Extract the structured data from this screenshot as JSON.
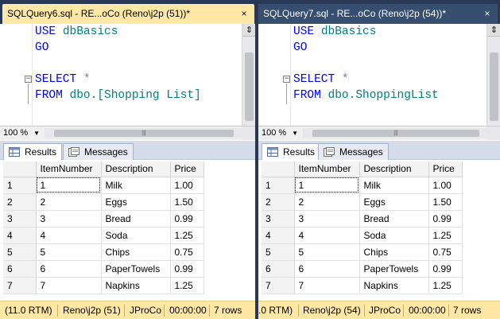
{
  "panes": [
    {
      "tab_title": "SQLQuery6.sql - RE...oCo (Reno\\j2p (51))*",
      "tab_close": "×",
      "code": {
        "line1_kw": "USE",
        "line1_id": "dbBasics",
        "line2_kw": "GO",
        "line3_kw": "SELECT",
        "line3_op": "*",
        "line4_kw": "FROM",
        "line4_id": "dbo.[Shopping List]"
      },
      "zoom": "100 %",
      "results_tab": "Results",
      "messages_tab": "Messages",
      "grid": {
        "headers": [
          "ItemNumber",
          "Description",
          "Price"
        ],
        "rows": [
          [
            "1",
            "1",
            "Milk",
            "1.00"
          ],
          [
            "2",
            "2",
            "Eggs",
            "1.50"
          ],
          [
            "3",
            "3",
            "Bread",
            "0.99"
          ],
          [
            "4",
            "4",
            "Soda",
            "1.25"
          ],
          [
            "5",
            "5",
            "Chips",
            "0.75"
          ],
          [
            "6",
            "6",
            "PaperTowels",
            "0.99"
          ],
          [
            "7",
            "7",
            "Napkins",
            "1.25"
          ]
        ]
      },
      "status": {
        "version": "(11.0 RTM)",
        "user": "Reno\\j2p (51)",
        "database": "JProCo",
        "elapsed": "00:00:00",
        "rows": "7 rows"
      }
    },
    {
      "tab_title": "SQLQuery7.sql - RE...oCo (Reno\\j2p (54))*",
      "tab_close": "×",
      "code": {
        "line1_kw": "USE",
        "line1_id": "dbBasics",
        "line2_kw": "GO",
        "line3_kw": "SELECT",
        "line3_op": "*",
        "line4_kw": "FROM",
        "line4_id": "dbo.ShoppingList"
      },
      "zoom": "100 %",
      "results_tab": "Results",
      "messages_tab": "Messages",
      "grid": {
        "headers": [
          "ItemNumber",
          "Description",
          "Price"
        ],
        "rows": [
          [
            "1",
            "1",
            "Milk",
            "1.00"
          ],
          [
            "2",
            "2",
            "Eggs",
            "1.50"
          ],
          [
            "3",
            "3",
            "Bread",
            "0.99"
          ],
          [
            "4",
            "4",
            "Soda",
            "1.25"
          ],
          [
            "5",
            "5",
            "Chips",
            "0.75"
          ],
          [
            "6",
            "6",
            "PaperTowels",
            "0.99"
          ],
          [
            "7",
            "7",
            "Napkins",
            "1.25"
          ]
        ]
      },
      "status": {
        "version": ".0 RTM)",
        "user": "Reno\\j2p (54)",
        "database": "JProCo",
        "elapsed": "00:00:00",
        "rows": "7 rows"
      }
    }
  ],
  "icons": {
    "split": "⇕",
    "zoom_dropdown": "chevron-down-icon",
    "scroll_grip": "grip-icon",
    "results": "grid-icon",
    "messages": "messages-icon"
  },
  "colors": {
    "frame": "#293955",
    "active_tab": "#ffe8a6",
    "inactive_tab": "#364e6f",
    "keyword": "#0000ff",
    "identifier": "#008080",
    "operator": "#808080",
    "statusbar": "#ffe8a6"
  }
}
